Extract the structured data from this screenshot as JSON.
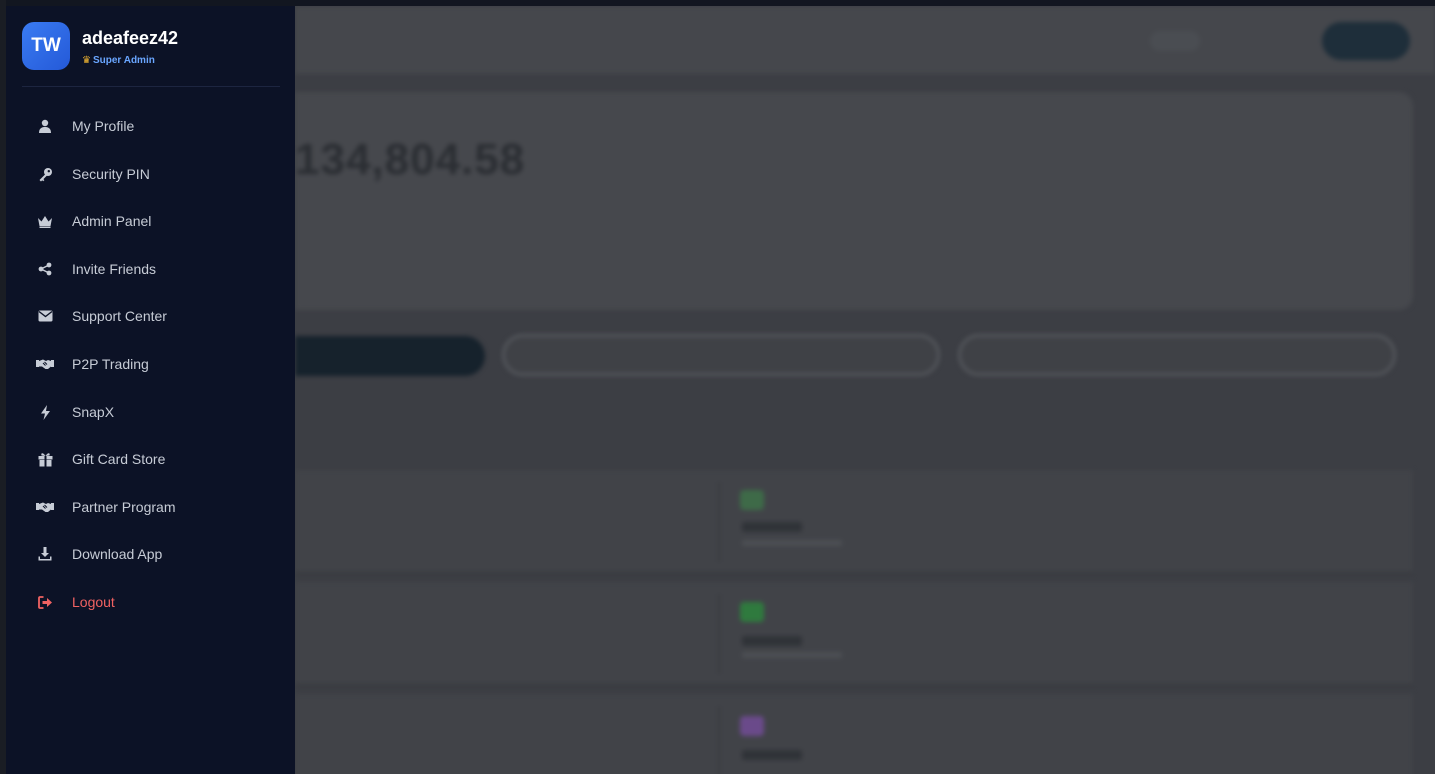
{
  "user": {
    "initials": "TW",
    "username": "adeafeez42",
    "role": "Super Admin"
  },
  "menu": {
    "items": [
      {
        "label": "My Profile",
        "icon": "user-icon"
      },
      {
        "label": "Security PIN",
        "icon": "key-icon"
      },
      {
        "label": "Admin Panel",
        "icon": "crown-icon"
      },
      {
        "label": "Invite Friends",
        "icon": "share-icon"
      },
      {
        "label": "Support Center",
        "icon": "envelope-icon"
      },
      {
        "label": "P2P Trading",
        "icon": "handshake-icon"
      },
      {
        "label": "SnapX",
        "icon": "bolt-icon"
      },
      {
        "label": "Gift Card Store",
        "icon": "gift-icon"
      },
      {
        "label": "Partner Program",
        "icon": "handshake-icon"
      },
      {
        "label": "Download App",
        "icon": "download-icon"
      },
      {
        "label": "Logout",
        "icon": "logout-icon"
      }
    ]
  },
  "background": {
    "balance": "134,804.58"
  },
  "colors": {
    "drawer_bg": "#0c1226",
    "avatar_blue": "#2f6cf0",
    "role_blue": "#6aa6ff",
    "logout_red": "#f06262",
    "menu_text": "#c7ccd6"
  }
}
